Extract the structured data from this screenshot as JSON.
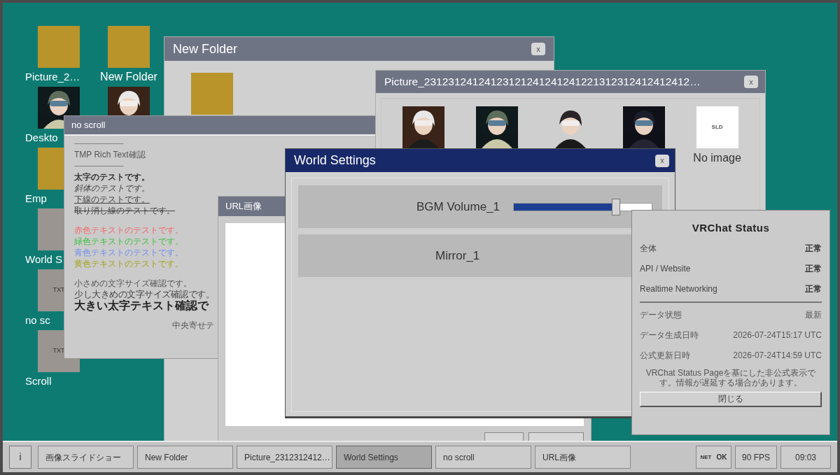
{
  "desktop": {
    "columns": [
      [
        {
          "kind": "folder",
          "label": "Picture_2…"
        },
        {
          "kind": "avatar",
          "label": "Deskto"
        },
        {
          "kind": "folder",
          "label": "Emp"
        },
        {
          "kind": "blank",
          "label": "World S"
        },
        {
          "kind": "text",
          "badge": "TXT",
          "label": "no sc"
        },
        {
          "kind": "text",
          "badge": "TXT",
          "label": "Scroll"
        }
      ],
      [
        {
          "kind": "folder",
          "label": "New Folder"
        },
        {
          "kind": "avatar"
        }
      ]
    ]
  },
  "new_folder_window": {
    "title": "New Folder",
    "close": "x"
  },
  "no_scroll_window": {
    "title": "no scroll",
    "sections": [
      [
        {
          "kind": "rule",
          "text": "------------------------------"
        },
        {
          "kind": "plain",
          "text": "TMP Rich Text確認"
        },
        {
          "kind": "rule",
          "text": "------------------------------"
        },
        {
          "kind": "bold",
          "text": "太字のテストです。"
        },
        {
          "kind": "italic",
          "text": "斜体のテストです。"
        },
        {
          "kind": "underline",
          "text": "下線のテストです。"
        },
        {
          "kind": "strike",
          "text": "取り消し線のテストです。"
        }
      ],
      [
        {
          "kind": "colored",
          "color": "#f26a6a",
          "text": "赤色テキストのテストです。"
        },
        {
          "kind": "colored",
          "color": "#3fbf3f",
          "text": "緑色テキストのテストです。"
        },
        {
          "kind": "colored",
          "color": "#6f8fef",
          "text": "青色テキストのテストです。"
        },
        {
          "kind": "colored",
          "color": "#a3a31c",
          "text": "黄色テキストのテストです。"
        }
      ],
      [
        {
          "kind": "small",
          "text": "小さめの文字サイズ確認です。"
        },
        {
          "kind": "large",
          "text": "少し大きめの文字サイズ確認です。"
        },
        {
          "kind": "xlarge",
          "text": "大きい太字テキスト確認で"
        }
      ],
      [
        {
          "kind": "centered",
          "text": "中央寄せテ"
        }
      ]
    ]
  },
  "picture_window": {
    "title": "Picture_23123124124123121241241241221312312412412412…",
    "close": "x",
    "items": [
      {
        "kind": "picture"
      },
      {
        "kind": "picture"
      },
      {
        "kind": "picture"
      },
      {
        "kind": "picture"
      },
      {
        "kind": "placeholder",
        "badge": "SLD",
        "caption": "No image"
      }
    ]
  },
  "url_window": {
    "title": "URL画像"
  },
  "world_settings_window": {
    "title": "World Settings",
    "close": "x",
    "rows": [
      {
        "kind": "slider",
        "label": "BGM Volume_1",
        "level": 0.74
      },
      {
        "kind": "toggle",
        "label": "Mirror_1"
      }
    ]
  },
  "status_panel": {
    "title": "VRChat Status",
    "groups": [
      [
        {
          "kind": "service",
          "label": "全体",
          "value": "正常"
        },
        {
          "kind": "service",
          "label": "API / Website",
          "value": "正常"
        },
        {
          "kind": "service",
          "label": "Realtime Networking",
          "value": "正常"
        }
      ],
      [
        {
          "kind": "meta",
          "label": "データ状態",
          "value": "最新"
        },
        {
          "kind": "meta",
          "label": "データ生成日時",
          "value": "2026-07-24T15:17 UTC"
        },
        {
          "kind": "meta",
          "label": "公式更新日時",
          "value": "2026-07-24T14:59 UTC"
        }
      ]
    ],
    "note": "VRChat Status Pageを基にした非公式表示です。情報が遅延する場合があります。",
    "button": "閉じる"
  },
  "taskbar": {
    "info": "i",
    "tasks": [
      {
        "label": "画像スライドショー",
        "selected": false
      },
      {
        "label": "New Folder",
        "selected": false
      },
      {
        "label": "Picture_2312312412…",
        "selected": false
      },
      {
        "label": "World Settings",
        "selected": true
      },
      {
        "label": "no scroll",
        "selected": false
      },
      {
        "label": "URL画像",
        "selected": false
      }
    ],
    "net_label": "NET",
    "net_value": "OK",
    "fps": "90 FPS",
    "clock": "09:03"
  }
}
